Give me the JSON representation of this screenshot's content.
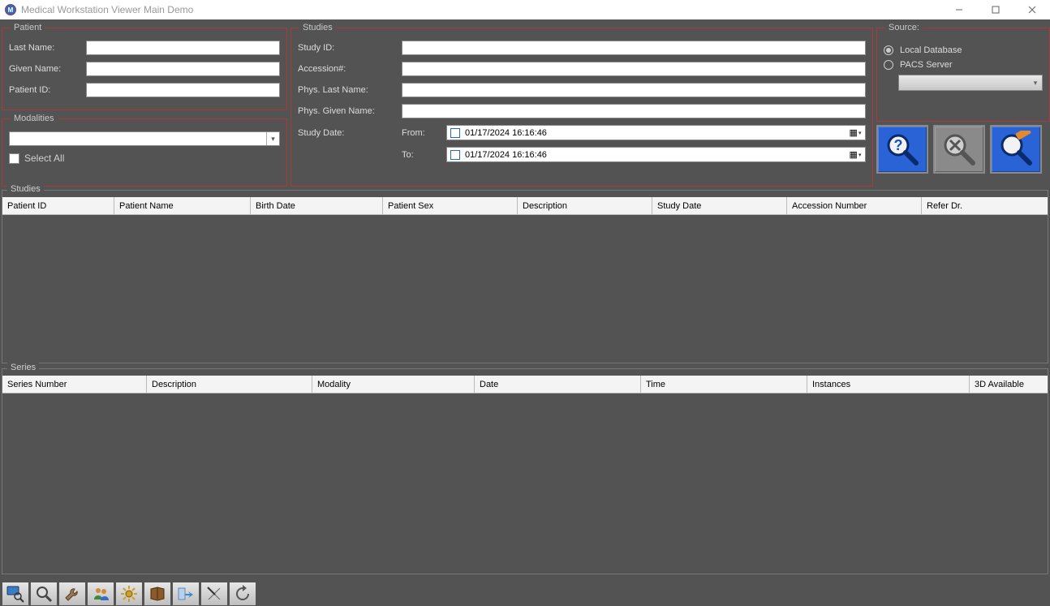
{
  "titlebar": {
    "title": "Medical Workstation Viewer Main Demo"
  },
  "patient": {
    "legend": "Patient",
    "last_name_label": "Last Name:",
    "given_name_label": "Given Name:",
    "patient_id_label": "Patient ID:",
    "last_name": "",
    "given_name": "",
    "patient_id": ""
  },
  "modalities": {
    "legend": "Modalities",
    "value": "",
    "select_all_label": "Select All"
  },
  "studies_filter": {
    "legend": "Studies",
    "study_id_label": "Study ID:",
    "accession_label": "Accession#:",
    "phys_last_label": "Phys. Last Name:",
    "phys_given_label": "Phys. Given Name:",
    "study_date_label": "Study Date:",
    "from_label": "From:",
    "to_label": "To:",
    "date_from": "01/17/2024 16:16:46",
    "date_to": "01/17/2024 16:16:46",
    "study_id": "",
    "accession": "",
    "phys_last": "",
    "phys_given": ""
  },
  "source": {
    "legend": "Source:",
    "local_label": "Local Database",
    "pacs_label": "PACS Server",
    "selected": "local",
    "server": ""
  },
  "studies_results": {
    "legend": "Studies",
    "columns": [
      "Patient ID",
      "Patient Name",
      "Birth Date",
      "Patient Sex",
      "Description",
      "Study Date",
      "Accession Number",
      "Refer Dr."
    ]
  },
  "series_results": {
    "legend": "Series",
    "columns": [
      "Series Number",
      "Description",
      "Modality",
      "Date",
      "Time",
      "Instances",
      "3D Available"
    ]
  }
}
